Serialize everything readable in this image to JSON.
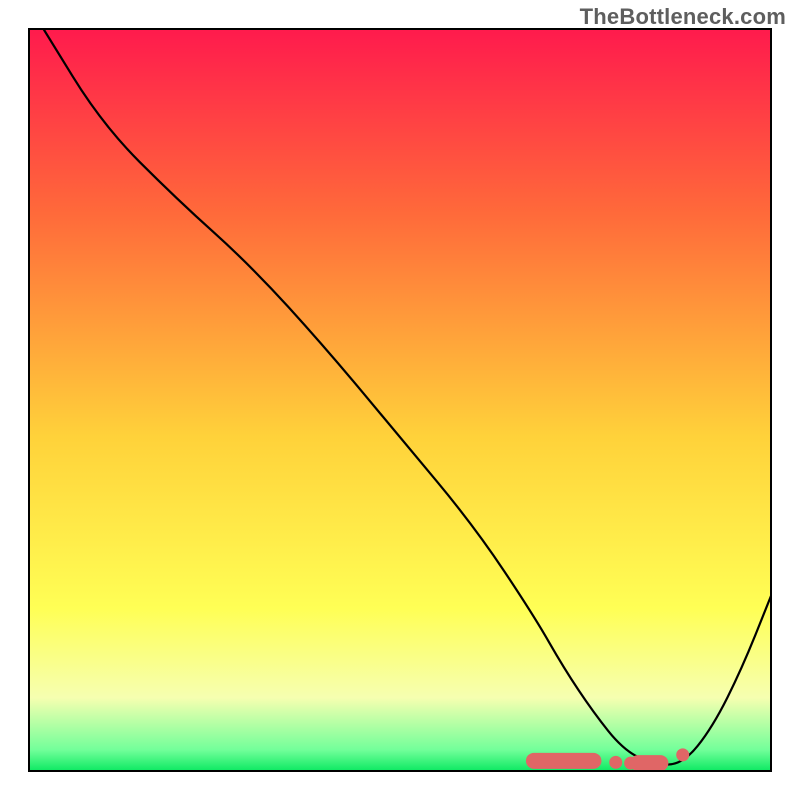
{
  "watermark": "TheBottleneck.com",
  "chart_data": {
    "type": "line",
    "title": "",
    "xlabel": "",
    "ylabel": "",
    "xlim": [
      0,
      100
    ],
    "ylim": [
      0,
      100
    ],
    "grid": false,
    "series": [
      {
        "name": "bottleneck-curve",
        "x": [
          2,
          10,
          20,
          30,
          40,
          50,
          60,
          68,
          72,
          76,
          80,
          84,
          88,
          92,
          96,
          100
        ],
        "y": [
          100,
          87,
          77,
          68,
          57,
          45,
          33,
          21,
          14,
          8,
          3,
          1,
          1,
          6,
          14,
          24
        ]
      }
    ],
    "markers": [
      {
        "shape": "round-bar",
        "x0": 68,
        "x1": 76,
        "y": 1.5
      },
      {
        "shape": "dot",
        "x": 79,
        "y": 1.3
      },
      {
        "shape": "dot",
        "x": 81,
        "y": 1.2
      },
      {
        "shape": "round-bar",
        "x0": 82,
        "x1": 85,
        "y": 1.2
      },
      {
        "shape": "dot",
        "x": 88,
        "y": 2.3
      }
    ],
    "background_gradient": {
      "stops": [
        {
          "offset": 0.0,
          "color": "#ff1a4d"
        },
        {
          "offset": 0.25,
          "color": "#ff6a3a"
        },
        {
          "offset": 0.55,
          "color": "#ffd23a"
        },
        {
          "offset": 0.78,
          "color": "#ffff55"
        },
        {
          "offset": 0.9,
          "color": "#f6ffb0"
        },
        {
          "offset": 0.97,
          "color": "#73ff9a"
        },
        {
          "offset": 1.0,
          "color": "#08e860"
        }
      ]
    }
  }
}
